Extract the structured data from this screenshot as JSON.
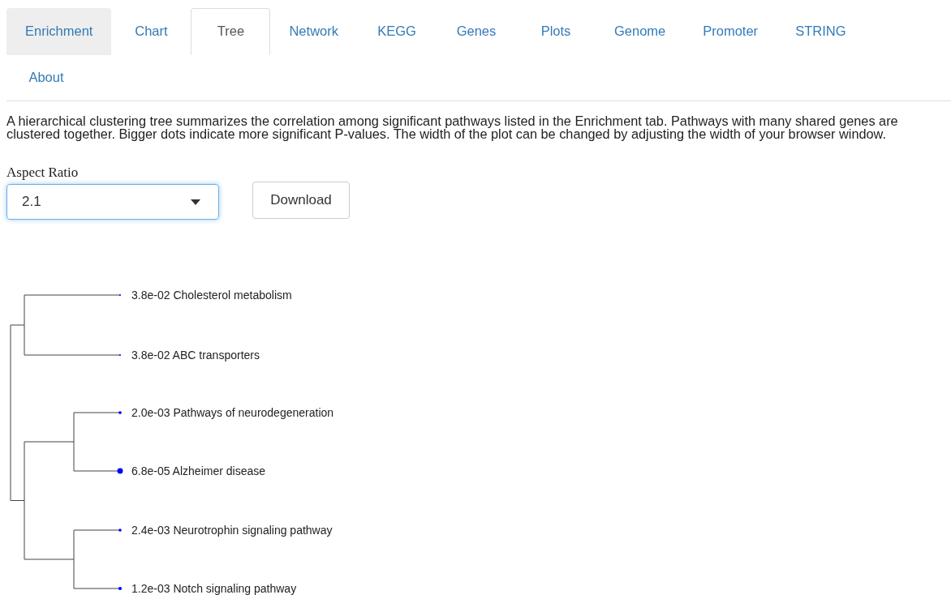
{
  "tabs": [
    {
      "label": "Enrichment",
      "selected": false,
      "hovered": true
    },
    {
      "label": "Chart",
      "selected": false,
      "hovered": false
    },
    {
      "label": "Tree",
      "selected": true,
      "hovered": false
    },
    {
      "label": "Network",
      "selected": false,
      "hovered": false
    },
    {
      "label": "KEGG",
      "selected": false,
      "hovered": false
    },
    {
      "label": "Genes",
      "selected": false,
      "hovered": false
    },
    {
      "label": "Plots",
      "selected": false,
      "hovered": false
    },
    {
      "label": "Genome",
      "selected": false,
      "hovered": false
    },
    {
      "label": "Promoter",
      "selected": false,
      "hovered": false
    },
    {
      "label": "STRING",
      "selected": false,
      "hovered": false
    },
    {
      "label": "About",
      "selected": false,
      "hovered": false
    }
  ],
  "description": "A hierarchical clustering tree summarizes the correlation among significant pathways listed in the Enrichment tab. Pathways with many shared genes are clustered together. Bigger dots indicate more significant P-values. The width of the plot can be changed by adjusting the width of your browser window.",
  "aspect_ratio": {
    "label": "Aspect Ratio",
    "value": "2.1"
  },
  "download_button": "Download",
  "tree": {
    "children": [
      {
        "children": [
          {
            "p_value": "3.8e-02",
            "pathway": "Cholesterol metabolism"
          },
          {
            "p_value": "3.8e-02",
            "pathway": "ABC transporters"
          }
        ]
      },
      {
        "children": [
          {
            "children": [
              {
                "p_value": "2.0e-03",
                "pathway": "Pathways of neurodegeneration"
              },
              {
                "p_value": "6.8e-05",
                "pathway": "Alzheimer disease"
              }
            ]
          },
          {
            "children": [
              {
                "p_value": "2.4e-03",
                "pathway": "Neurotrophin signaling pathway"
              },
              {
                "p_value": "1.2e-03",
                "pathway": "Notch signaling pathway"
              }
            ]
          }
        ]
      }
    ]
  }
}
